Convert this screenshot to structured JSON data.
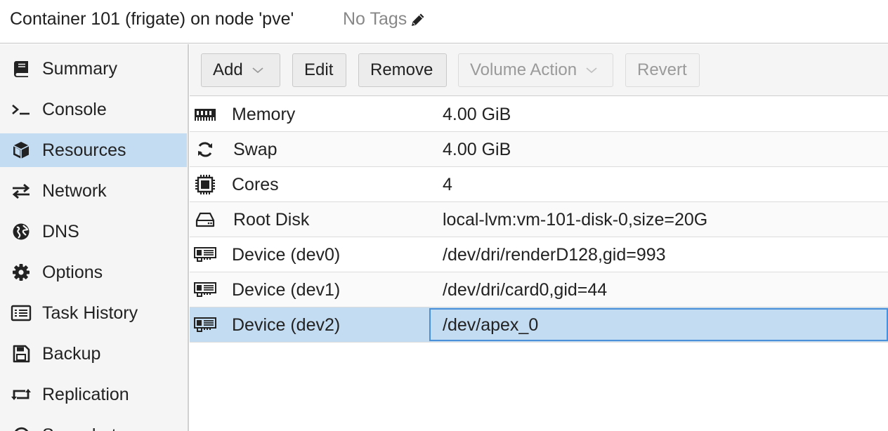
{
  "header": {
    "title": "Container 101 (frigate) on node 'pve'",
    "tags_label": "No Tags",
    "tags_icon": "pencil-icon"
  },
  "sidebar": {
    "items": [
      {
        "label": "Summary",
        "icon": "book-icon"
      },
      {
        "label": "Console",
        "icon": "terminal-icon"
      },
      {
        "label": "Resources",
        "icon": "cube-icon",
        "selected": true
      },
      {
        "label": "Network",
        "icon": "exchange-icon"
      },
      {
        "label": "DNS",
        "icon": "globe-icon"
      },
      {
        "label": "Options",
        "icon": "gear-icon"
      },
      {
        "label": "Task History",
        "icon": "list-icon"
      },
      {
        "label": "Backup",
        "icon": "floppy-icon"
      },
      {
        "label": "Replication",
        "icon": "retweet-icon"
      },
      {
        "label": "Snapshots",
        "icon": "history-icon"
      }
    ]
  },
  "toolbar": {
    "add_label": "Add",
    "edit_label": "Edit",
    "remove_label": "Remove",
    "volume_action_label": "Volume Action",
    "revert_label": "Revert"
  },
  "resources": {
    "rows": [
      {
        "name": "Memory",
        "value": "4.00 GiB",
        "icon": "memory-icon"
      },
      {
        "name": "Swap",
        "value": "4.00 GiB",
        "icon": "refresh-icon"
      },
      {
        "name": "Cores",
        "value": "4",
        "icon": "cpu-icon"
      },
      {
        "name": "Root Disk",
        "value": "local-lvm:vm-101-disk-0,size=20G",
        "icon": "hdd-icon"
      },
      {
        "name": "Device (dev0)",
        "value": "/dev/dri/renderD128,gid=993",
        "icon": "device-card-icon"
      },
      {
        "name": "Device (dev1)",
        "value": "/dev/dri/card0,gid=44",
        "icon": "device-card-icon"
      },
      {
        "name": "Device (dev2)",
        "value": "/dev/apex_0",
        "icon": "device-card-icon",
        "selected": true
      }
    ]
  },
  "colors": {
    "selection": "#c4dcf2",
    "focus_border": "#4a90d9",
    "disabled_text": "#9a9a9a"
  }
}
